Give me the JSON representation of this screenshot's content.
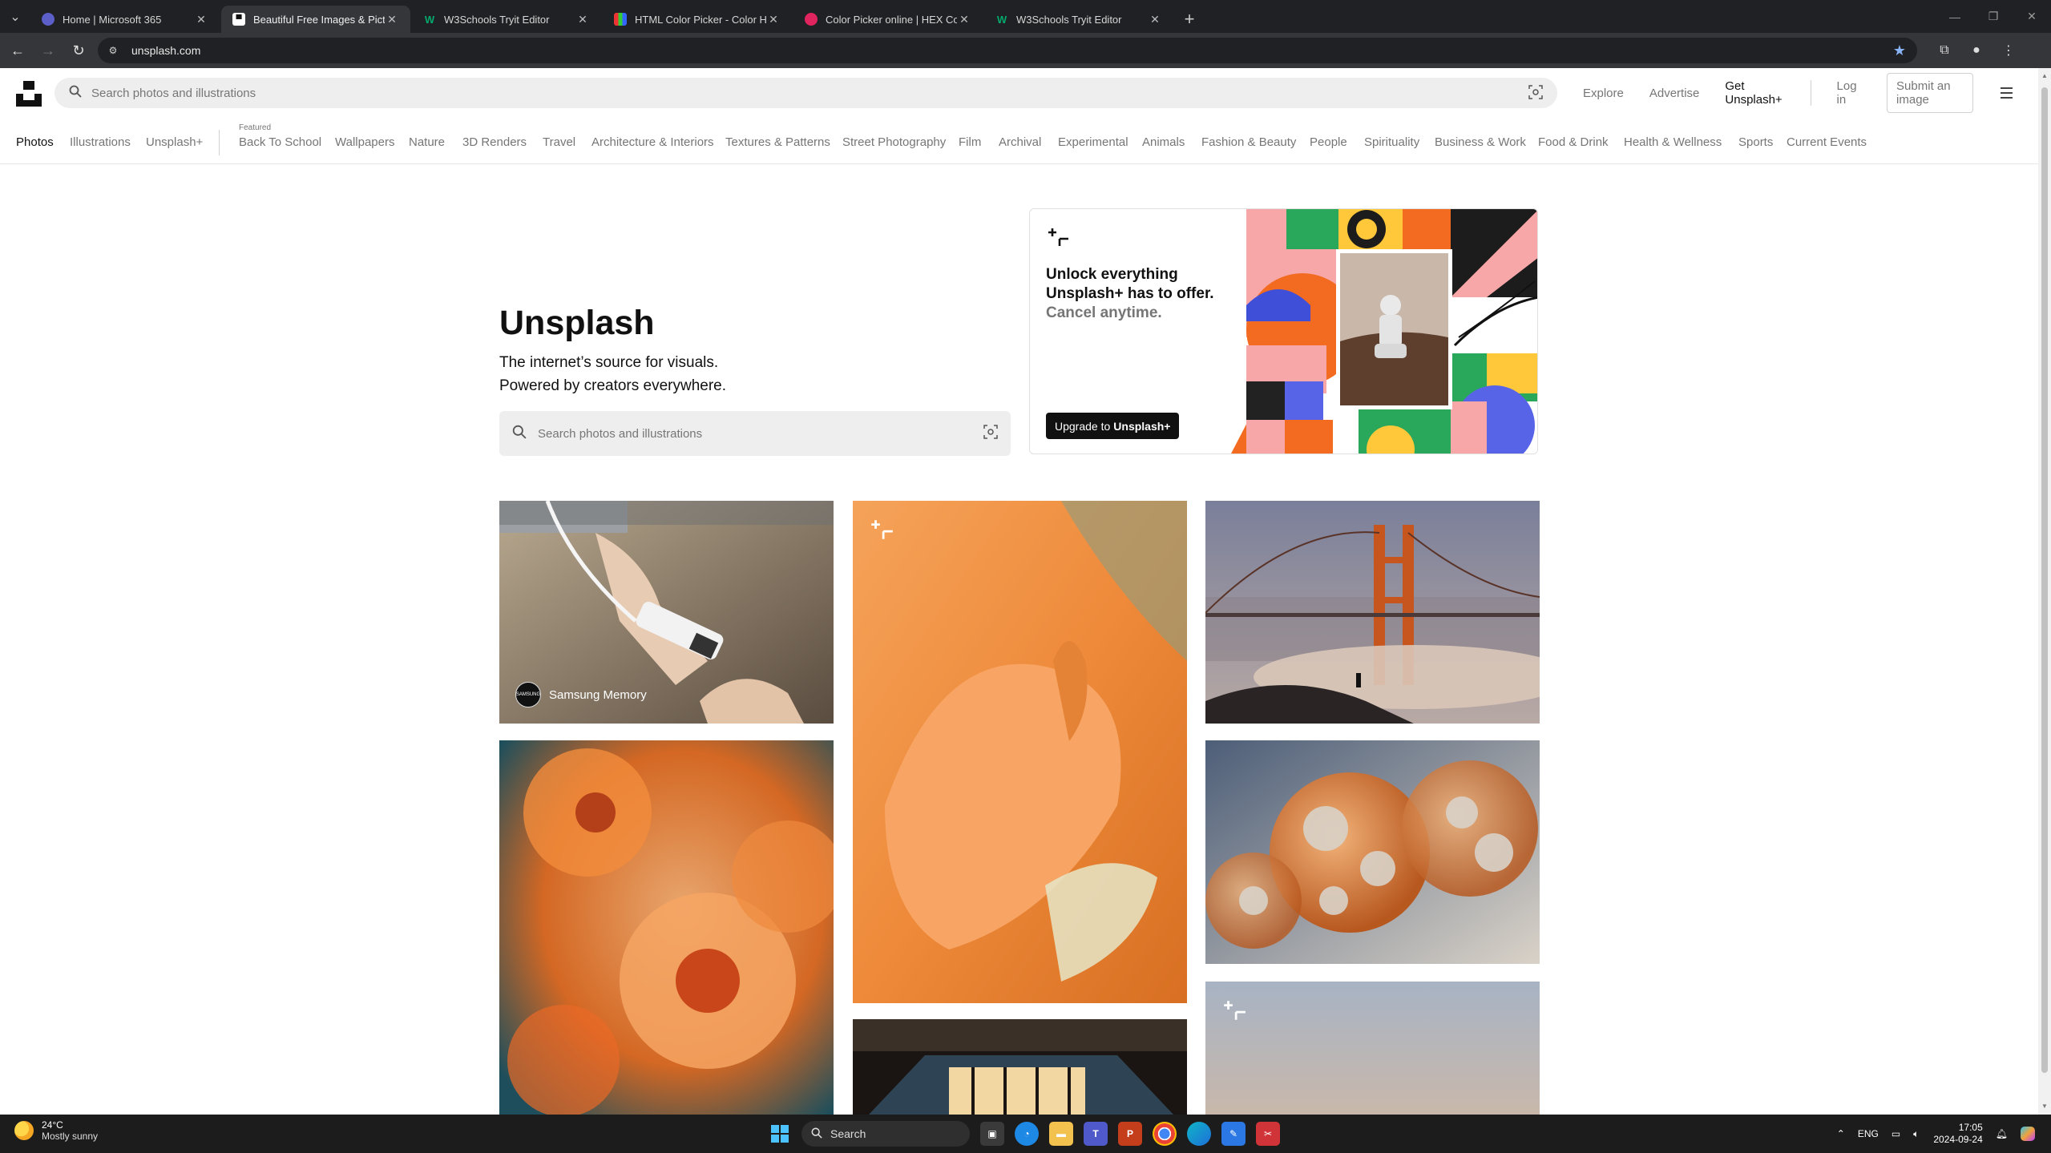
{
  "browser": {
    "tabs": [
      {
        "title": "Home | Microsoft 365",
        "favicon": "m365-icon",
        "active": false
      },
      {
        "title": "Beautiful Free Images & Pictures",
        "favicon": "unsplash-icon",
        "active": true
      },
      {
        "title": "W3Schools Tryit Editor",
        "favicon": "w3schools-icon",
        "active": false
      },
      {
        "title": "HTML Color Picker - Color Hex",
        "favicon": "colorhex-icon",
        "active": false
      },
      {
        "title": "Color Picker online | HEX Co",
        "favicon": "colorpicker-icon",
        "active": false
      },
      {
        "title": "W3Schools Tryit Editor",
        "favicon": "w3schools-icon",
        "active": false
      }
    ],
    "url": "unsplash.com"
  },
  "header": {
    "search_placeholder": "Search photos and illustrations",
    "links": {
      "explore": "Explore",
      "advertise": "Advertise",
      "get_plus": "Get Unsplash+",
      "login": "Log in",
      "submit": "Submit an image"
    }
  },
  "categories": {
    "photos": "Photos",
    "illustrations": "Illustrations",
    "unsplash_plus": "Unsplash+",
    "featured_label": "Featured",
    "items": [
      "Back To School",
      "Wallpapers",
      "Nature",
      "3D Renders",
      "Travel",
      "Architecture & Interiors",
      "Textures & Patterns",
      "Street Photography",
      "Film",
      "Archival",
      "Experimental",
      "Animals",
      "Fashion & Beauty",
      "People",
      "Spirituality",
      "Business & Work",
      "Food & Drink",
      "Health & Wellness",
      "Sports",
      "Current Events"
    ]
  },
  "hero": {
    "title": "Unsplash",
    "line1": "The internet’s source for visuals.",
    "line2": "Powered by creators everywhere.",
    "search_placeholder": "Search photos and illustrations"
  },
  "promo": {
    "line1": "Unlock everything",
    "line2": "Unsplash+ has to offer.",
    "line3": "Cancel anytime.",
    "button_prefix": "Upgrade to",
    "button_brand": "Unsplash+"
  },
  "photos": {
    "sponsor_name": "Samsung Memory",
    "sponsor_avatar_text": "SAMSUNG"
  },
  "taskbar": {
    "temperature": "24°C",
    "weather": "Mostly sunny",
    "search_label": "Search",
    "lang": "ENG",
    "time": "17:05",
    "date": "2024-09-24"
  },
  "colors": {
    "unsplash_black": "#111111",
    "muted_text": "#767676",
    "search_bg": "#eeeeee",
    "chrome_dark": "#202124",
    "chrome_tab": "#35363a",
    "bookmark_star": "#8ab4f8"
  }
}
